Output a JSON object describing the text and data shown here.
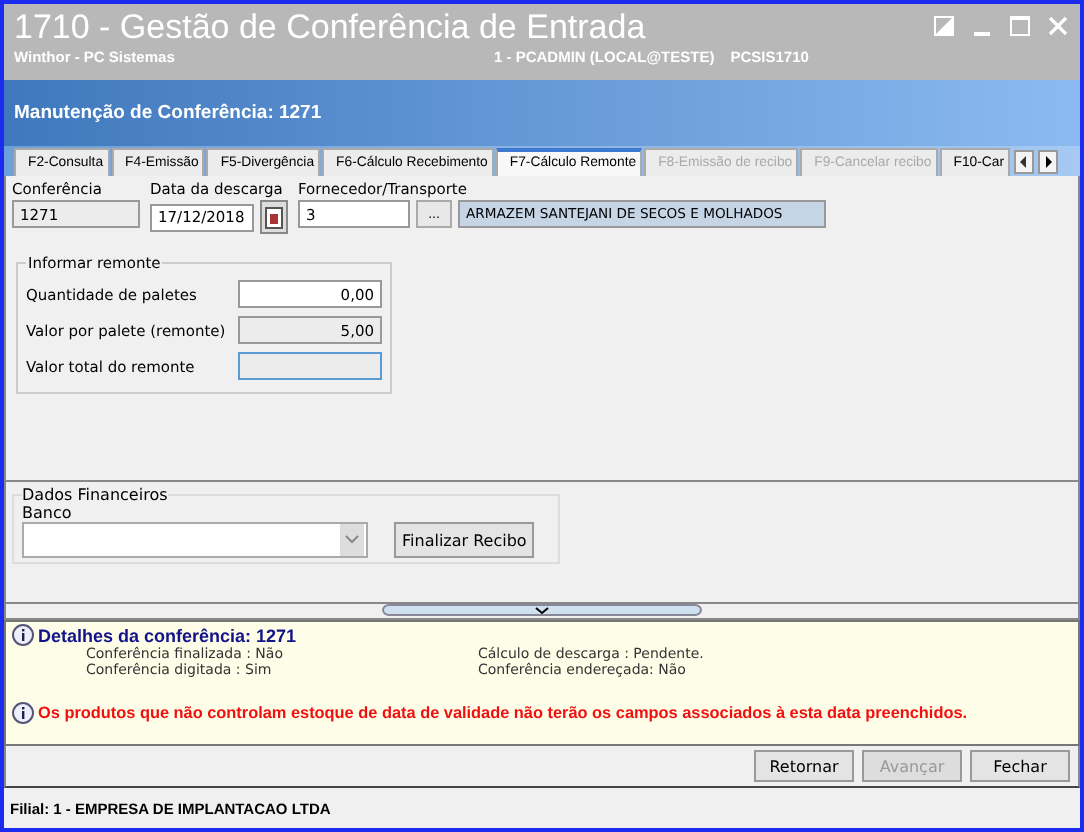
{
  "window": {
    "title": "1710 - Gestão de Conferência de Entrada",
    "subtitle": "Winthor - PC Sistemas",
    "user": "1 - PCADMIN (LOCAL@TESTE)",
    "module": "PCSIS1710"
  },
  "header": {
    "title": "Manutenção de Conferência: 1271"
  },
  "tabs": [
    {
      "label": "F2-Consulta",
      "selected": false,
      "disabled": false
    },
    {
      "label": "F4-Emissão",
      "selected": false,
      "disabled": false
    },
    {
      "label": "F5-Divergência",
      "selected": false,
      "disabled": false
    },
    {
      "label": "F6-Cálculo Recebimento",
      "selected": false,
      "disabled": false
    },
    {
      "label": "F7-Cálculo Remonte",
      "selected": true,
      "disabled": false
    },
    {
      "label": "F8-Emissão de recibo",
      "selected": false,
      "disabled": true
    },
    {
      "label": "F9-Cancelar recibo",
      "selected": false,
      "disabled": true
    },
    {
      "label": "F10-Car",
      "selected": false,
      "disabled": false
    }
  ],
  "top_fields": {
    "conferencia": {
      "label": "Conferência",
      "value": "1271"
    },
    "data": {
      "label": "Data da descarga",
      "value": "17/12/2018"
    },
    "fornecedor": {
      "label": "Fornecedor/Transporte",
      "code": "3",
      "lookup": "...",
      "name": "ARMAZEM SANTEJANI DE SECOS E MOLHADOS"
    }
  },
  "remonte": {
    "title": "Informar remonte",
    "rows": [
      {
        "label": "Quantidade de paletes",
        "value": "0,00",
        "kind": "editable"
      },
      {
        "label": "Valor por palete (remonte)",
        "value": "5,00",
        "kind": "readonly"
      },
      {
        "label": "Valor total do remonte",
        "kind": "focused"
      }
    ]
  },
  "financeiro": {
    "title": "Dados Financeiros",
    "bank_label": "Banco",
    "button": "Finalizar Recibo"
  },
  "details": {
    "title": "Detalhes da conferência: 1271",
    "items": [
      "Conferência finalizada : Não",
      "Cálculo de descarga : Pendente.",
      "Conferência digitada : Sim",
      "Conferência endereçada: Não"
    ],
    "warning": "Os produtos que não controlam estoque de data de validade não terão os campos associados à esta data preenchidos."
  },
  "buttons": [
    {
      "label": "Retornar",
      "disabled": false
    },
    {
      "label": "Avançar",
      "disabled": true
    },
    {
      "label": "Fechar",
      "disabled": false
    }
  ],
  "status_bar": "Filial: 1 - EMPRESA DE IMPLANTACAO LTDA"
}
